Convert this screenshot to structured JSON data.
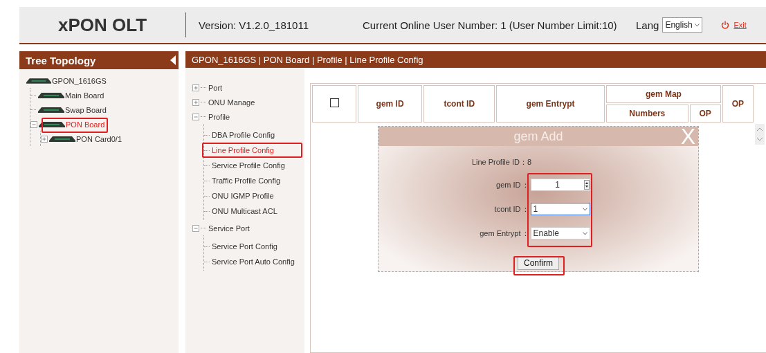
{
  "header": {
    "logo": "xPON OLT",
    "version": "Version: V1.2.0_181011",
    "online_users": "Current Online User Number: 1 (User Number Limit:10)",
    "lang_label": "Lang",
    "lang_value": "English",
    "exit": "Exit"
  },
  "tree_topology": {
    "title": "Tree Topology",
    "root": {
      "label": "GPON_1616GS",
      "children": [
        {
          "label": "Main Board",
          "kind": "leaf",
          "selected": false
        },
        {
          "label": "Swap Board",
          "kind": "leaf",
          "selected": false
        },
        {
          "label": "PON Board",
          "kind": "branch",
          "expanded": true,
          "selected": true,
          "children": [
            {
              "label": "PON Card0/1",
              "kind": "branch",
              "expanded": false,
              "selected": false
            }
          ]
        }
      ]
    }
  },
  "breadcrumb": "GPON_1616GS | PON Board | Profile | Line Profile Config",
  "nav": [
    {
      "label": "Port",
      "expanded": false
    },
    {
      "label": "ONU Manage",
      "expanded": false
    },
    {
      "label": "Profile",
      "expanded": true,
      "children": [
        {
          "label": "DBA Profile Config",
          "selected": false
        },
        {
          "label": "Line Profile Config",
          "selected": true
        },
        {
          "label": "Service Profile Config",
          "selected": false
        },
        {
          "label": "Traffic Profile Config",
          "selected": false
        },
        {
          "label": "ONU IGMP Profile",
          "selected": false
        },
        {
          "label": "ONU Multicast ACL",
          "selected": false
        }
      ]
    },
    {
      "label": "Service Port",
      "expanded": true,
      "children": [
        {
          "label": "Service Port Config",
          "selected": false
        },
        {
          "label": "Service Port Auto Config",
          "selected": false
        }
      ]
    }
  ],
  "table": {
    "select_all_checked": false,
    "columns": [
      "gem ID",
      "tcont ID",
      "gem Entrypt"
    ],
    "group": {
      "label": "gem Map",
      "subcolumns": [
        "Numbers",
        "OP"
      ]
    },
    "last_column": "OP"
  },
  "dialog": {
    "title": "gem Add",
    "close": "X",
    "info": "Line Profile ID：8",
    "fields": [
      {
        "kind": "spinner",
        "label": "gem ID",
        "separator": "：",
        "value": "1",
        "focused": false
      },
      {
        "kind": "select",
        "label": "tcont ID",
        "separator": "：",
        "value": "1",
        "focused": true
      },
      {
        "kind": "select",
        "label": "gem Entrypt",
        "separator": "：",
        "value": "Enable",
        "focused": false
      }
    ],
    "button": "Confirm"
  }
}
